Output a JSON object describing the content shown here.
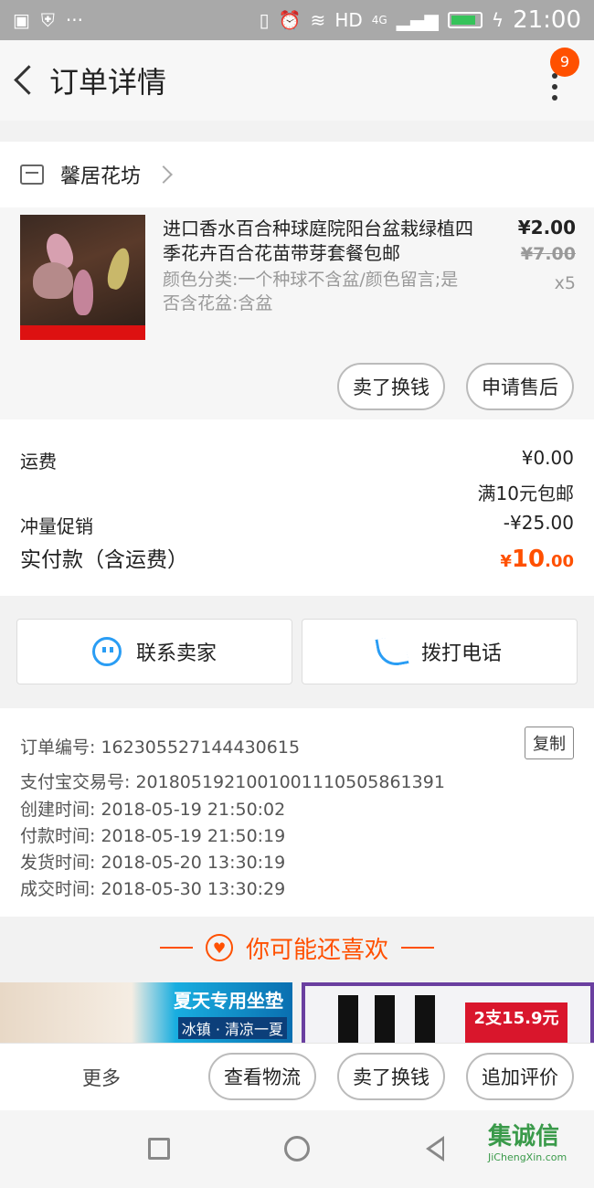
{
  "status_bar": {
    "network": "HD",
    "network_gen": "4G",
    "time": "21:00"
  },
  "header": {
    "title": "订单详情",
    "badge_count": "9"
  },
  "shop": {
    "name": "馨居花坊"
  },
  "product": {
    "title": "进口香水百合种球庭院阳台盆栽绿植四季花卉百合花苗带芽套餐包邮",
    "spec": "颜色分类:一个种球不含盆/颜色留言;是否含花盆:含盆",
    "price": "¥2.00",
    "original_price": "¥7.00",
    "quantity": "x5",
    "buttons": {
      "sell": "卖了换钱",
      "after_sale": "申请售后"
    }
  },
  "fees": {
    "shipping_label": "运费",
    "shipping_value": "¥0.00",
    "shipping_note": "满10元包邮",
    "promo_label": "冲量促销",
    "promo_value": "-¥25.00",
    "total_label": "实付款（含运费）",
    "total_currency": "¥",
    "total_int": "10",
    "total_dec": ".00"
  },
  "contact": {
    "seller": "联系卖家",
    "call": "拨打电话"
  },
  "order_info": {
    "order_no": "订单编号: 162305527144430615",
    "copy": "复制",
    "alipay_no": "支付宝交易号: 2018051921001001110505861391",
    "created": "创建时间: 2018-05-19 21:50:02",
    "paid": "付款时间: 2018-05-19 21:50:19",
    "shipped": "发货时间: 2018-05-20 13:30:19",
    "completed": "成交时间: 2018-05-30 13:30:29"
  },
  "recommend": {
    "title": "你可能还喜欢",
    "item_a_tag1": "夏天专用坐垫",
    "item_a_tag2": "冰镇 · 清凉一夏",
    "item_b_tag": "2支15.9元"
  },
  "bottom_bar": {
    "more": "更多",
    "logistics": "查看物流",
    "sell": "卖了换钱",
    "review": "追加评价"
  },
  "watermark": {
    "name": "集诚信",
    "url": "JiChengXin.com"
  },
  "colors": {
    "accent": "#ff5000",
    "link_blue": "#2a9df4",
    "statusbar": "#a9a9a9"
  }
}
